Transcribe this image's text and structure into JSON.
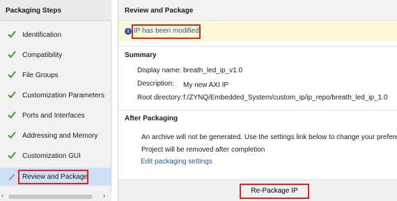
{
  "left_panel": {
    "title": "Packaging Steps",
    "steps": [
      {
        "label": "Identification",
        "state": "done"
      },
      {
        "label": "Compatibility",
        "state": "done"
      },
      {
        "label": "File Groups",
        "state": "done"
      },
      {
        "label": "Customization Parameters",
        "state": "done"
      },
      {
        "label": "Ports and Interfaces",
        "state": "done"
      },
      {
        "label": "Addressing and Memory",
        "state": "done"
      },
      {
        "label": "Customization GUI",
        "state": "done"
      },
      {
        "label": "Review and Package",
        "state": "current"
      }
    ]
  },
  "right_panel": {
    "title": "Review and Package",
    "banner": {
      "text": "IP has been modified."
    },
    "summary": {
      "heading": "Summary",
      "display_name_label": "Display name:",
      "display_name_value": "breath_led_ip_v1.0",
      "description_label": "Description:",
      "description_value": "My new AXI IP",
      "root_dir_label": "Root directory:",
      "root_dir_value": "f:/ZYNQ/Embedded_System/custom_ip/ip_repo/breath_led_ip_1.0"
    },
    "after_packaging": {
      "heading": "After Packaging",
      "line1": "An archive will not be generated. Use the settings link below to change your preference",
      "line2": "Project will be removed after completion",
      "link": "Edit packaging settings"
    },
    "footer": {
      "button_label": "Re-Package IP"
    }
  },
  "colors": {
    "check": "#3a9a2a",
    "link": "#1f57a6",
    "highlight": "#e0231b",
    "active_row": "#cfe0f6",
    "banner_bg": "#fdf8d8"
  }
}
